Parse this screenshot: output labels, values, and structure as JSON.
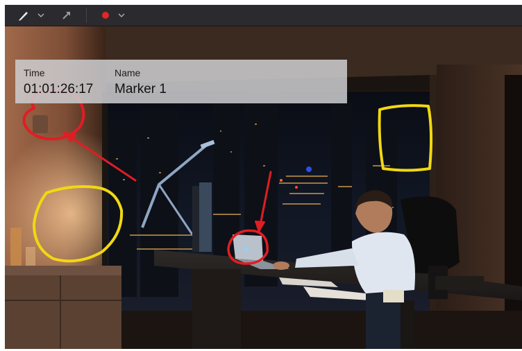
{
  "toolbar": {
    "pen_tool": "pen-icon",
    "arrow_tool": "arrow-icon",
    "color_indicator": "#e0262a",
    "dropdown": "chevron-down-icon"
  },
  "marker": {
    "time_label": "Time",
    "name_label": "Name",
    "time_value": "01:01:26:17",
    "name_value": "Marker 1"
  },
  "annotations": {
    "red_color": "#e11d24",
    "yellow_color": "#f1d812"
  },
  "scene": "night office with city skyline; man working at laptop"
}
